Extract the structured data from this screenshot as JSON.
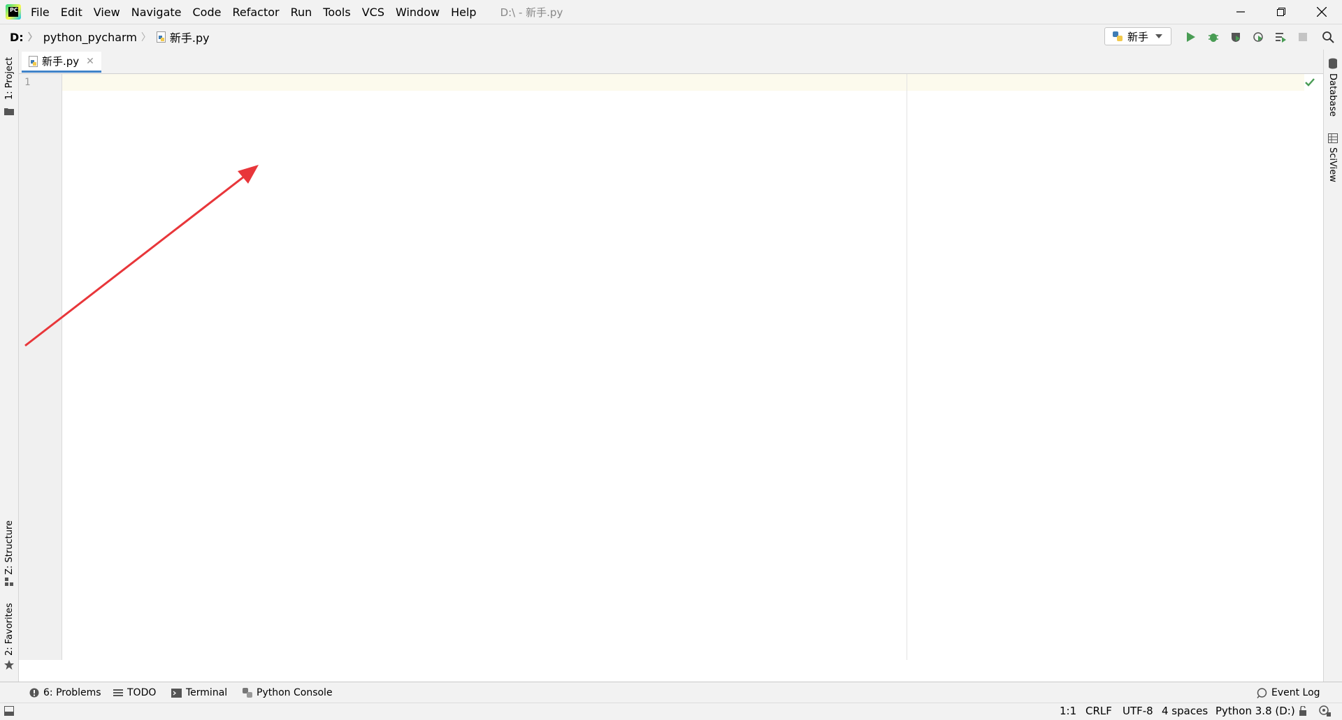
{
  "menubar": {
    "logo_text": "PC",
    "items": [
      {
        "label": "File",
        "name": "menu-file"
      },
      {
        "label": "Edit",
        "name": "menu-edit"
      },
      {
        "label": "View",
        "name": "menu-view"
      },
      {
        "label": "Navigate",
        "name": "menu-navigate"
      },
      {
        "label": "Code",
        "name": "menu-code"
      },
      {
        "label": "Refactor",
        "name": "menu-refactor"
      },
      {
        "label": "Run",
        "name": "menu-run"
      },
      {
        "label": "Tools",
        "name": "menu-tools"
      },
      {
        "label": "VCS",
        "name": "menu-vcs"
      },
      {
        "label": "Window",
        "name": "menu-window"
      },
      {
        "label": "Help",
        "name": "menu-help"
      }
    ],
    "window_title": "D:\\ - 新手.py"
  },
  "navbar": {
    "drive": "D:",
    "project": "python_pycharm",
    "file": "新手.py",
    "run_config": "新手"
  },
  "left_stripe": {
    "project": "1: Project",
    "structure": "Z: Structure",
    "favorites": "2: Favorites"
  },
  "right_stripe": {
    "database": "Database",
    "sciview": "SciView"
  },
  "editor": {
    "tab_label": "新手.py",
    "tab_close": "✕",
    "line_number": "1"
  },
  "bottom_tools": {
    "problems": "6: Problems",
    "todo": "TODO",
    "terminal": "Terminal",
    "python_console": "Python Console",
    "event_log": "Event Log"
  },
  "statusbar": {
    "position": "1:1",
    "line_ending": "CRLF",
    "encoding": "UTF-8",
    "indent": "4 spaces",
    "interpreter": "Python 3.8 (D:)"
  },
  "colors": {
    "accent": "#4083c9",
    "run_green": "#499c54",
    "arrow_red": "#e8363a"
  }
}
